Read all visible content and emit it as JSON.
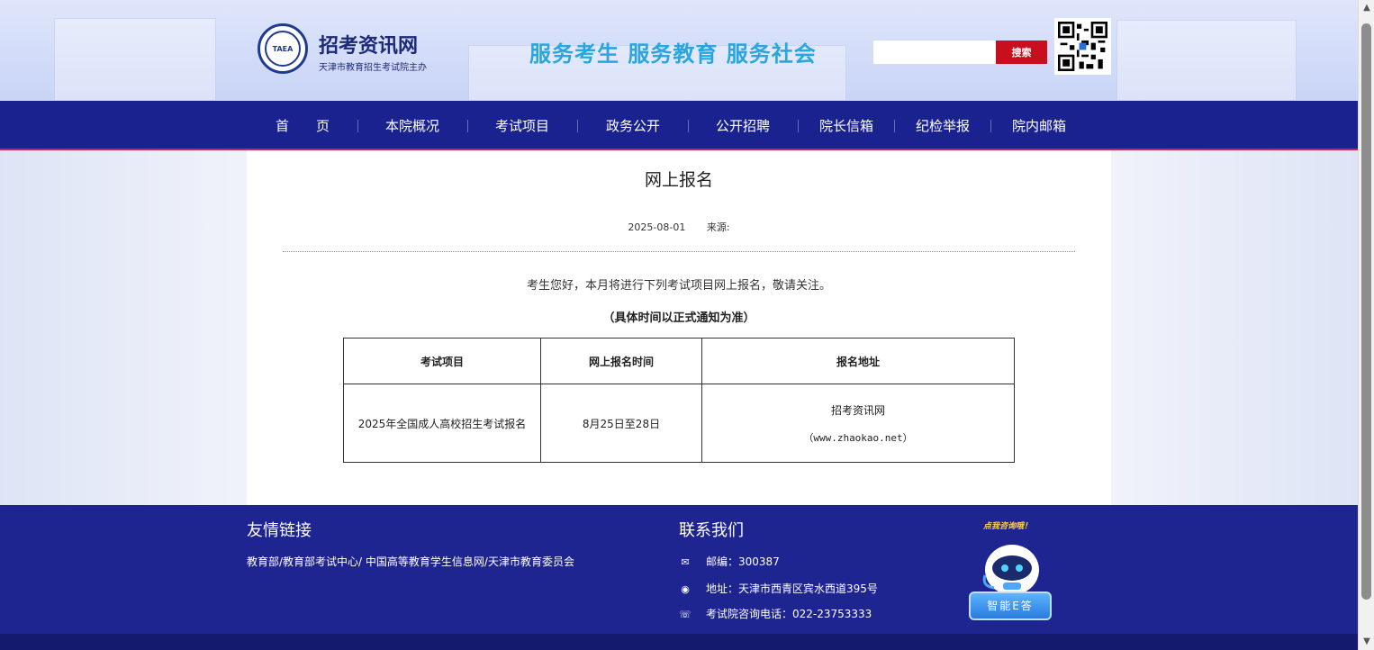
{
  "header": {
    "site_name": "招考资讯网",
    "site_sub": "天津市教育招生考试院主办",
    "logo_text": "TAEA",
    "slogan": "服务考生  服务教育  服务社会",
    "search_placeholder": "",
    "search_label": "搜索",
    "qr_icon": "qr-code-icon"
  },
  "nav": {
    "items": [
      {
        "label": "首　　页"
      },
      {
        "label": "本院概况"
      },
      {
        "label": "考试项目"
      },
      {
        "label": "政务公开"
      },
      {
        "label": "公开招聘"
      },
      {
        "label": "院长信箱"
      },
      {
        "label": "纪检举报"
      },
      {
        "label": "院内邮箱"
      }
    ]
  },
  "article": {
    "title": "网上报名",
    "date": "2025-08-01",
    "source_label": "来源:",
    "intro": "考生您好，本月将进行下列考试项目网上报名，敬请关注。",
    "note": "（具体时间以正式通知为准）",
    "table": {
      "headers": [
        "考试项目",
        "网上报名时间",
        "报名地址"
      ],
      "rows": [
        {
          "project": "2025年全国成人高校招生考试报名",
          "time": "8月25日至28日",
          "addr_name": "招考资讯网",
          "addr_url": "（www.zhaokao.net）"
        }
      ]
    }
  },
  "footer": {
    "friend_title": "友情链接",
    "friend_links": "教育部/教育部考试中心/ 中国高等教育学生信息网/天津市教育委员会",
    "contact_title": "联系我们",
    "contacts": [
      {
        "icon": "mail-icon",
        "text": "邮编：300387"
      },
      {
        "icon": "location-icon",
        "text": "地址：天津市西青区宾水西道395号"
      },
      {
        "icon": "phone-icon",
        "text": "考试院咨询电话：022-23753333"
      }
    ],
    "robot_bubble": "点我咨询哦！",
    "robot_caption": "智能E答"
  },
  "colors": {
    "nav_bg": "#1a2290",
    "footer_bg": "#1e2590",
    "search_button": "#c80f1e",
    "slogan": "#29a6e0"
  }
}
